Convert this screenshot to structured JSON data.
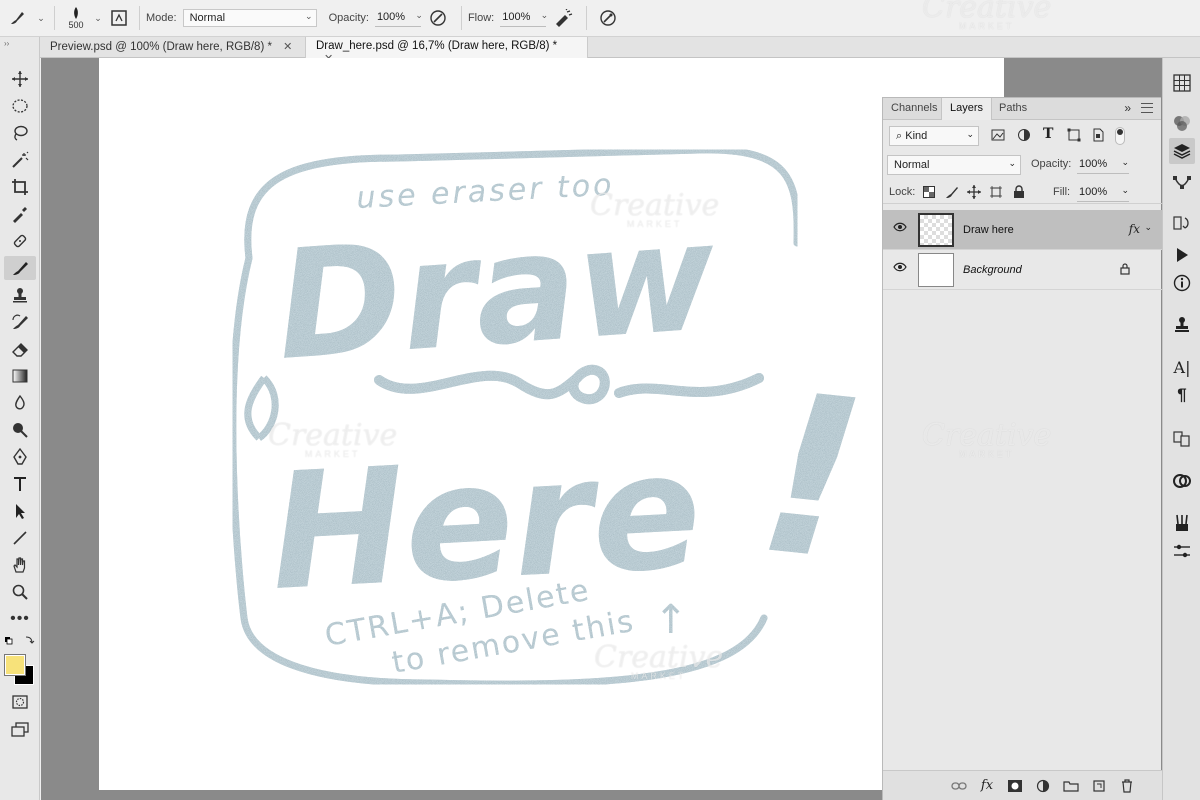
{
  "options_bar": {
    "brush_size": "500",
    "mode_label": "Mode:",
    "mode_value": "Normal",
    "opacity_label": "Opacity:",
    "opacity_value": "100%",
    "flow_label": "Flow:",
    "flow_value": "100%"
  },
  "tabs": [
    {
      "label": "Preview.psd @ 100% (Draw here, RGB/8) *"
    },
    {
      "label": "Draw_here.psd @ 16,7% (Draw here, RGB/8) *"
    }
  ],
  "canvas": {
    "artwork_lines": {
      "top_note": "use eraser too",
      "headline_1": "Draw",
      "headline_2": "Here",
      "exclaim": "!",
      "bottom_note_1": "CTRL+A; Delete",
      "bottom_note_2": "to remove this",
      "arrow": "↑"
    },
    "glitter_color": "#a9bcc4"
  },
  "layers_panel": {
    "tabs": [
      "Channels",
      "Layers",
      "Paths"
    ],
    "active_tab": "Layers",
    "filter_label": "Kind",
    "blend_mode": "Normal",
    "opacity_label": "Opacity:",
    "opacity_value": "100%",
    "lock_label": "Lock:",
    "fill_label": "Fill:",
    "fill_value": "100%",
    "layers": [
      {
        "name": "Draw here",
        "fx": "fx",
        "selected": true
      },
      {
        "name": "Background",
        "locked": true
      }
    ]
  },
  "watermark": {
    "brand": "Creative",
    "sub": "MARKET"
  },
  "colors": {
    "foreground": "#f7e27a",
    "background": "#000000"
  }
}
